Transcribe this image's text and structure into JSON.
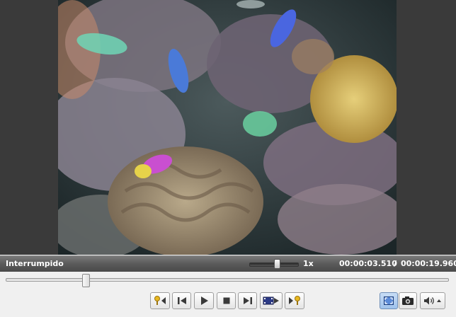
{
  "player": {
    "status": "Interrumpido",
    "speed": "1x",
    "speed_level": 0.6,
    "time_current": "00:00:03.510",
    "time_separator": "/",
    "time_total": "00:00:19.960",
    "seek_progress": 0.176
  },
  "controls": {
    "icons": [
      "mark-in-icon",
      "previous-frame-icon",
      "play-icon",
      "stop-icon",
      "next-frame-icon",
      "film-strip-icon",
      "mark-out-icon",
      "fullscreen-icon",
      "camera-icon",
      "volume-icon",
      "menu-arrow-icon"
    ]
  },
  "colors": {
    "status_bar": "#5a5a5a",
    "marker": "#e8b820",
    "icon": "#3a3a3a"
  }
}
